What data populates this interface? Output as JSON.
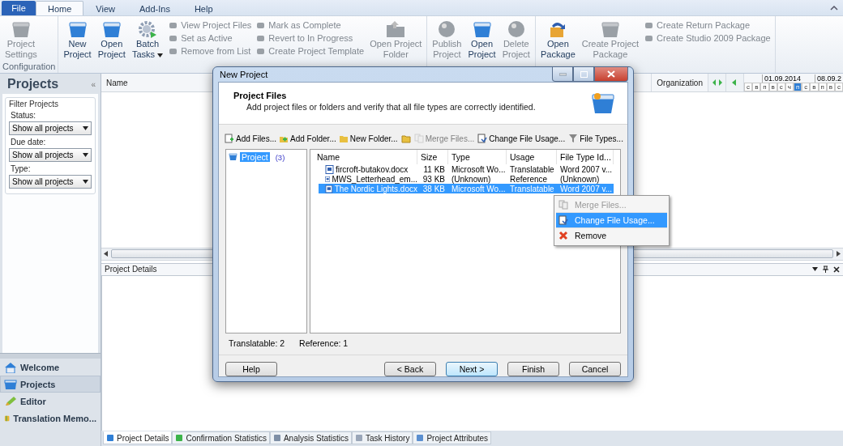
{
  "ribbon": {
    "tabs": [
      {
        "label": "File",
        "kind": "file",
        "selected": false
      },
      {
        "label": "Home",
        "kind": "tab",
        "selected": true
      },
      {
        "label": "View",
        "kind": "tab",
        "selected": false
      },
      {
        "label": "Add-Ins",
        "kind": "tab",
        "selected": false
      },
      {
        "label": "Help",
        "kind": "tab",
        "selected": false
      }
    ],
    "groups": [
      {
        "label": "Configuration",
        "items": [
          {
            "kind": "large",
            "lines": [
              "Project",
              "Settings"
            ],
            "disabled": true,
            "dropdown": false
          }
        ]
      },
      {
        "items": [
          {
            "kind": "large",
            "lines": [
              "New",
              "Project"
            ],
            "disabled": false,
            "dropdown": false
          },
          {
            "kind": "large",
            "lines": [
              "Open",
              "Project"
            ],
            "disabled": false,
            "dropdown": false
          },
          {
            "kind": "large",
            "lines": [
              "Batch",
              "Tasks"
            ],
            "disabled": false,
            "dropdown": true
          },
          {
            "kind": "small",
            "entries": [
              {
                "label": "View Project Files",
                "disabled": true
              },
              {
                "label": "Set as Active",
                "disabled": true
              },
              {
                "label": "Remove from List",
                "disabled": true
              }
            ]
          },
          {
            "kind": "small",
            "entries": [
              {
                "label": "Mark as Complete",
                "disabled": true
              },
              {
                "label": "Revert to In Progress",
                "disabled": true
              },
              {
                "label": "Create Project Template",
                "disabled": true
              }
            ]
          },
          {
            "kind": "large",
            "lines": [
              "Open Project",
              "Folder"
            ],
            "disabled": true,
            "dropdown": false
          }
        ]
      },
      {
        "items": [
          {
            "kind": "large",
            "lines": [
              "Publish",
              "Project"
            ],
            "disabled": true,
            "dropdown": false
          },
          {
            "kind": "large",
            "lines": [
              "Open",
              "Project"
            ],
            "disabled": false,
            "dropdown": false
          },
          {
            "kind": "large",
            "lines": [
              "Delete",
              "Project"
            ],
            "disabled": true,
            "dropdown": false
          }
        ]
      },
      {
        "items": [
          {
            "kind": "large",
            "lines": [
              "Open",
              "Package"
            ],
            "disabled": false,
            "dropdown": false
          },
          {
            "kind": "large",
            "lines": [
              "Create Project",
              "Package"
            ],
            "disabled": true,
            "dropdown": false
          },
          {
            "kind": "small",
            "entries": [
              {
                "label": "Create Return Package",
                "disabled": true
              },
              {
                "label": "Create Studio 2009 Package",
                "disabled": true
              }
            ]
          }
        ]
      }
    ]
  },
  "sidebar": {
    "title": "Projects",
    "collapse": "«",
    "filter": {
      "title": "Filter Projects",
      "fields": [
        {
          "label": "Status:",
          "value": "Show all projects"
        },
        {
          "label": "Due date:",
          "value": "Show all projects"
        },
        {
          "label": "Type:",
          "value": "Show all projects"
        }
      ]
    },
    "nav": [
      {
        "label": "Welcome",
        "selected": false
      },
      {
        "label": "Projects",
        "selected": true
      },
      {
        "label": "Editor",
        "selected": false
      },
      {
        "label": "Translation Memo...",
        "selected": false
      }
    ]
  },
  "grid": {
    "columns": [
      "Name",
      "Organization"
    ],
    "calendar": {
      "dates": [
        "01.09.2014",
        "08.09.2"
      ],
      "days": [
        {
          "label": "с",
          "selected": false
        },
        {
          "label": "в",
          "selected": false
        },
        {
          "label": "п",
          "selected": false
        },
        {
          "label": "в",
          "selected": false
        },
        {
          "label": "с",
          "selected": false
        },
        {
          "label": "ч",
          "selected": false
        },
        {
          "label": "п",
          "selected": true
        },
        {
          "label": "с",
          "selected": false
        },
        {
          "label": "в",
          "selected": false
        },
        {
          "label": "п",
          "selected": false
        },
        {
          "label": "в",
          "selected": false
        },
        {
          "label": "с",
          "selected": false
        }
      ]
    }
  },
  "details": {
    "title": "Project Details",
    "tabs": [
      {
        "label": "Project Details",
        "selected": true
      },
      {
        "label": "Confirmation Statistics",
        "selected": false
      },
      {
        "label": "Analysis Statistics",
        "selected": false
      },
      {
        "label": "Task History",
        "selected": false
      },
      {
        "label": "Project Attributes",
        "selected": false
      }
    ]
  },
  "dialog": {
    "title": "New Project",
    "header": {
      "title": "Project Files",
      "description": "Add project files or folders and verify that all file types are correctly identified."
    },
    "toolbar": [
      {
        "kind": "button",
        "label": "Add Files...",
        "disabled": false
      },
      {
        "kind": "button",
        "label": "Add Folder...",
        "disabled": false
      },
      {
        "kind": "button",
        "label": "New Folder...",
        "disabled": false
      },
      {
        "kind": "separator"
      },
      {
        "kind": "icon",
        "disabled": false
      },
      {
        "kind": "separator"
      },
      {
        "kind": "button",
        "label": "Merge Files...",
        "disabled": true
      },
      {
        "kind": "separator"
      },
      {
        "kind": "button",
        "label": "Change File Usage...",
        "disabled": false
      },
      {
        "kind": "separator"
      },
      {
        "kind": "button",
        "label": "File Types...",
        "disabled": false
      }
    ],
    "tree": [
      {
        "label": "Project",
        "count": "(3)",
        "selected": true
      }
    ],
    "files": {
      "columns": [
        "Name",
        "Size",
        "Type",
        "Usage",
        "File Type Id..."
      ],
      "rows": [
        {
          "cells": [
            "fircroft-butakov.docx",
            "11 KB",
            "Microsoft Wo...",
            "Translatable",
            "Word 2007 v..."
          ],
          "selected": false
        },
        {
          "cells": [
            "MWS_Letterhead_em...",
            "93 KB",
            "(Unknown)",
            "Reference",
            "(Unknown)"
          ],
          "selected": false
        },
        {
          "cells": [
            "The Nordic Lights.docx",
            "38 KB",
            "Microsoft Wo...",
            "Translatable",
            "Word 2007 v..."
          ],
          "selected": true
        }
      ]
    },
    "summary": [
      "Translatable: 2",
      "Reference: 1"
    ],
    "buttons": [
      {
        "label": "Help",
        "focused": false
      },
      {
        "label": "< Back",
        "focused": false
      },
      {
        "label": "Next >",
        "focused": true
      },
      {
        "label": "Finish",
        "focused": false
      },
      {
        "label": "Cancel",
        "focused": false
      }
    ],
    "context_menu": [
      {
        "label": "Merge Files...",
        "disabled": true,
        "selected": false
      },
      {
        "label": "Change File Usage...",
        "disabled": false,
        "selected": true
      },
      {
        "label": "Remove",
        "disabled": false,
        "selected": false
      }
    ]
  }
}
